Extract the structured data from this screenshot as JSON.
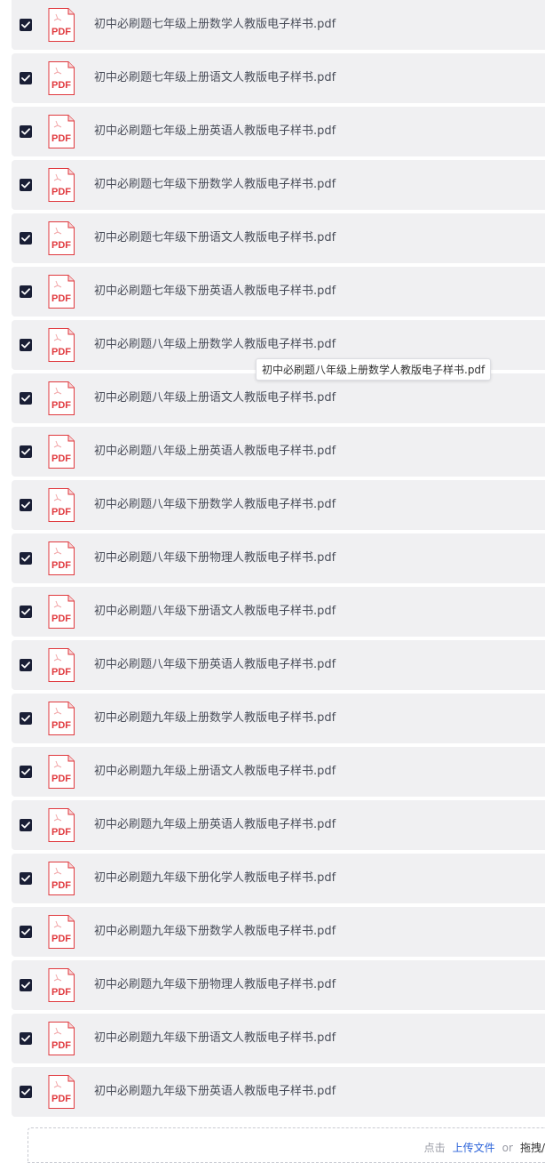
{
  "files": [
    {
      "name": "初中必刷题七年级上册数学人教版电子样书.pdf",
      "checked": true
    },
    {
      "name": "初中必刷题七年级上册语文人教版电子样书.pdf",
      "checked": true
    },
    {
      "name": "初中必刷题七年级上册英语人教版电子样书.pdf",
      "checked": true
    },
    {
      "name": "初中必刷题七年级下册数学人教版电子样书.pdf",
      "checked": true
    },
    {
      "name": "初中必刷题七年级下册语文人教版电子样书.pdf",
      "checked": true
    },
    {
      "name": "初中必刷题七年级下册英语人教版电子样书.pdf",
      "checked": true
    },
    {
      "name": "初中必刷题八年级上册数学人教版电子样书.pdf",
      "checked": true
    },
    {
      "name": "初中必刷题八年级上册语文人教版电子样书.pdf",
      "checked": true
    },
    {
      "name": "初中必刷题八年级上册英语人教版电子样书.pdf",
      "checked": true
    },
    {
      "name": "初中必刷题八年级下册数学人教版电子样书.pdf",
      "checked": true
    },
    {
      "name": "初中必刷题八年级下册物理人教版电子样书.pdf",
      "checked": true
    },
    {
      "name": "初中必刷题八年级下册语文人教版电子样书.pdf",
      "checked": true
    },
    {
      "name": "初中必刷题八年级下册英语人教版电子样书.pdf",
      "checked": true
    },
    {
      "name": "初中必刷题九年级上册数学人教版电子样书.pdf",
      "checked": true
    },
    {
      "name": "初中必刷题九年级上册语文人教版电子样书.pdf",
      "checked": true
    },
    {
      "name": "初中必刷题九年级上册英语人教版电子样书.pdf",
      "checked": true
    },
    {
      "name": "初中必刷题九年级下册化学人教版电子样书.pdf",
      "checked": true
    },
    {
      "name": "初中必刷题九年级下册数学人教版电子样书.pdf",
      "checked": true
    },
    {
      "name": "初中必刷题九年级下册物理人教版电子样书.pdf",
      "checked": true
    },
    {
      "name": "初中必刷题九年级下册语文人教版电子样书.pdf",
      "checked": true
    },
    {
      "name": "初中必刷题九年级下册英语人教版电子样书.pdf",
      "checked": true
    }
  ],
  "file_icon": {
    "label": "PDF",
    "color": "#e0393e"
  },
  "tooltip": {
    "text": "初中必刷题八年级上册数学人教版电子样书.pdf"
  },
  "upload": {
    "prefix": "点击",
    "link": "上传文件",
    "or": "or",
    "suffix": "拖拽/"
  },
  "colors": {
    "row_bg": "#f0f0f2",
    "checkbox": "#1a1f36",
    "link": "#2a62d9"
  }
}
